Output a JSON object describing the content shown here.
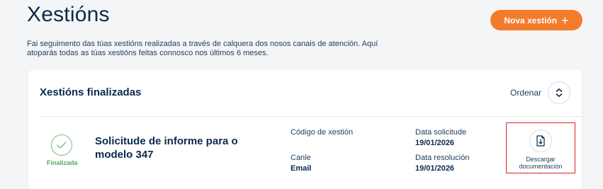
{
  "header": {
    "title": "Xestións",
    "new_button_label": "Nova xestión",
    "new_button_icon": "plus-icon",
    "description": "Fai seguimento das túas xestións realizadas a través de calquera dos nosos canais de atención. Aquí atoparás todas as túas xestións feitas connosco nos últimos 6 meses."
  },
  "card": {
    "title": "Xestións finalizadas",
    "sort_label": "Ordenar",
    "sort_icon": "sort-icon"
  },
  "request": {
    "status_label": "Finalizada",
    "status_icon": "check-circle-icon",
    "title": "Solicitude de informe para o modelo 347",
    "code_label": "Código de xestión",
    "code_value": "",
    "channel_label": "Canle",
    "channel_value": "Email",
    "request_date_label": "Data solicitude",
    "request_date_value": "19/01/2026",
    "resolution_date_label": "Data resolución",
    "resolution_date_value": "19/01/2026",
    "download_label": "Descargar documentación",
    "download_icon": "download-document-icon"
  },
  "colors": {
    "accent": "#f37c2c",
    "success": "#5aa95a",
    "primary_text": "#0b2a4a",
    "highlight_border": "#e0202a"
  }
}
